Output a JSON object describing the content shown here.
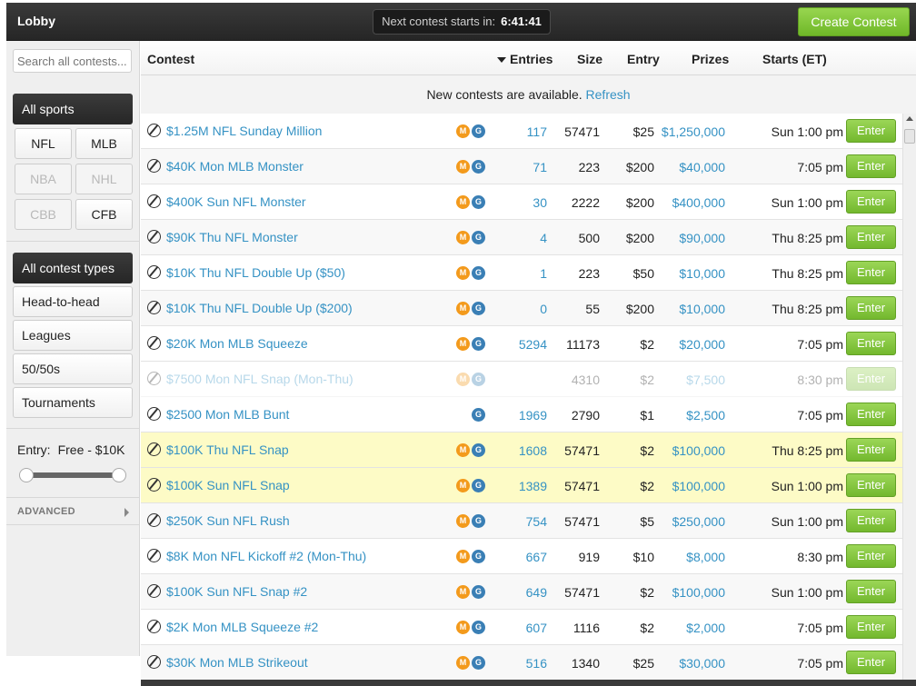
{
  "header": {
    "lobby_label": "Lobby",
    "countdown_label": "Next contest starts in:",
    "countdown_value": "6:41:41",
    "create_button": "Create Contest"
  },
  "sidebar": {
    "search_placeholder": "Search all contests...",
    "all_sports": "All sports",
    "sports": [
      {
        "label": "NFL",
        "enabled": true
      },
      {
        "label": "MLB",
        "enabled": true
      },
      {
        "label": "NBA",
        "enabled": false
      },
      {
        "label": "NHL",
        "enabled": false
      },
      {
        "label": "CBB",
        "enabled": false
      },
      {
        "label": "CFB",
        "enabled": true
      }
    ],
    "all_types": "All contest types",
    "types": [
      "Head-to-head",
      "Leagues",
      "50/50s",
      "Tournaments"
    ],
    "entry_label": "Entry:",
    "entry_range": "Free - $10K",
    "advanced": "ADVANCED"
  },
  "table": {
    "headers": {
      "contest": "Contest",
      "entries": "Entries",
      "size": "Size",
      "entry": "Entry",
      "prizes": "Prizes",
      "starts": "Starts (ET)"
    },
    "notice_text": "New contests are available.",
    "refresh": "Refresh",
    "enter_label": "Enter",
    "rows": [
      {
        "sport": "football",
        "name": "$1.25M NFL Sunday Million",
        "m": true,
        "g": true,
        "entries": "117",
        "size": "57471",
        "entry": "$25",
        "prizes": "$1,250,000",
        "starts": "Sun 1:00 pm",
        "style": "normal"
      },
      {
        "sport": "baseball",
        "name": "$40K Mon MLB Monster",
        "m": true,
        "g": true,
        "entries": "71",
        "size": "223",
        "entry": "$200",
        "prizes": "$40,000",
        "starts": "7:05 pm",
        "style": "alt"
      },
      {
        "sport": "football",
        "name": "$400K Sun NFL Monster",
        "m": true,
        "g": true,
        "entries": "30",
        "size": "2222",
        "entry": "$200",
        "prizes": "$400,000",
        "starts": "Sun 1:00 pm",
        "style": "normal"
      },
      {
        "sport": "football",
        "name": "$90K Thu NFL Monster",
        "m": true,
        "g": true,
        "entries": "4",
        "size": "500",
        "entry": "$200",
        "prizes": "$90,000",
        "starts": "Thu 8:25 pm",
        "style": "alt"
      },
      {
        "sport": "football",
        "name": "$10K Thu NFL Double Up ($50)",
        "m": true,
        "g": true,
        "entries": "1",
        "size": "223",
        "entry": "$50",
        "prizes": "$10,000",
        "starts": "Thu 8:25 pm",
        "style": "normal"
      },
      {
        "sport": "football",
        "name": "$10K Thu NFL Double Up ($200)",
        "m": true,
        "g": true,
        "entries": "0",
        "size": "55",
        "entry": "$200",
        "prizes": "$10,000",
        "starts": "Thu 8:25 pm",
        "style": "alt"
      },
      {
        "sport": "baseball",
        "name": "$20K Mon MLB Squeeze",
        "m": true,
        "g": true,
        "entries": "5294",
        "size": "11173",
        "entry": "$2",
        "prizes": "$20,000",
        "starts": "7:05 pm",
        "style": "normal"
      },
      {
        "sport": "football",
        "name": "$7500 Mon NFL Snap (Mon-Thu)",
        "m": true,
        "g": true,
        "entries": "",
        "size": "4310",
        "entry": "$2",
        "prizes": "$7,500",
        "starts": "8:30 pm",
        "style": "dim"
      },
      {
        "sport": "baseball",
        "name": "$2500 Mon MLB Bunt",
        "m": false,
        "g": true,
        "entries": "1969",
        "size": "2790",
        "entry": "$1",
        "prizes": "$2,500",
        "starts": "7:05 pm",
        "style": "normal"
      },
      {
        "sport": "football",
        "name": "$100K Thu NFL Snap",
        "m": true,
        "g": true,
        "entries": "1608",
        "size": "57471",
        "entry": "$2",
        "prizes": "$100,000",
        "starts": "Thu 8:25 pm",
        "style": "hl"
      },
      {
        "sport": "football",
        "name": "$100K Sun NFL Snap",
        "m": true,
        "g": true,
        "entries": "1389",
        "size": "57471",
        "entry": "$2",
        "prizes": "$100,000",
        "starts": "Sun 1:00 pm",
        "style": "hl"
      },
      {
        "sport": "football",
        "name": "$250K Sun NFL Rush",
        "m": true,
        "g": true,
        "entries": "754",
        "size": "57471",
        "entry": "$5",
        "prizes": "$250,000",
        "starts": "Sun 1:00 pm",
        "style": "alt"
      },
      {
        "sport": "football",
        "name": "$8K Mon NFL Kickoff #2 (Mon-Thu)",
        "m": true,
        "g": true,
        "entries": "667",
        "size": "919",
        "entry": "$10",
        "prizes": "$8,000",
        "starts": "8:30 pm",
        "style": "normal"
      },
      {
        "sport": "football",
        "name": "$100K Sun NFL Snap #2",
        "m": true,
        "g": true,
        "entries": "649",
        "size": "57471",
        "entry": "$2",
        "prizes": "$100,000",
        "starts": "Sun 1:00 pm",
        "style": "alt"
      },
      {
        "sport": "baseball",
        "name": "$2K Mon MLB Squeeze #2",
        "m": true,
        "g": true,
        "entries": "607",
        "size": "1116",
        "entry": "$2",
        "prizes": "$2,000",
        "starts": "7:05 pm",
        "style": "normal"
      },
      {
        "sport": "baseball",
        "name": "$30K Mon MLB Strikeout",
        "m": true,
        "g": true,
        "entries": "516",
        "size": "1340",
        "entry": "$25",
        "prizes": "$30,000",
        "starts": "7:05 pm",
        "style": "alt"
      }
    ]
  }
}
